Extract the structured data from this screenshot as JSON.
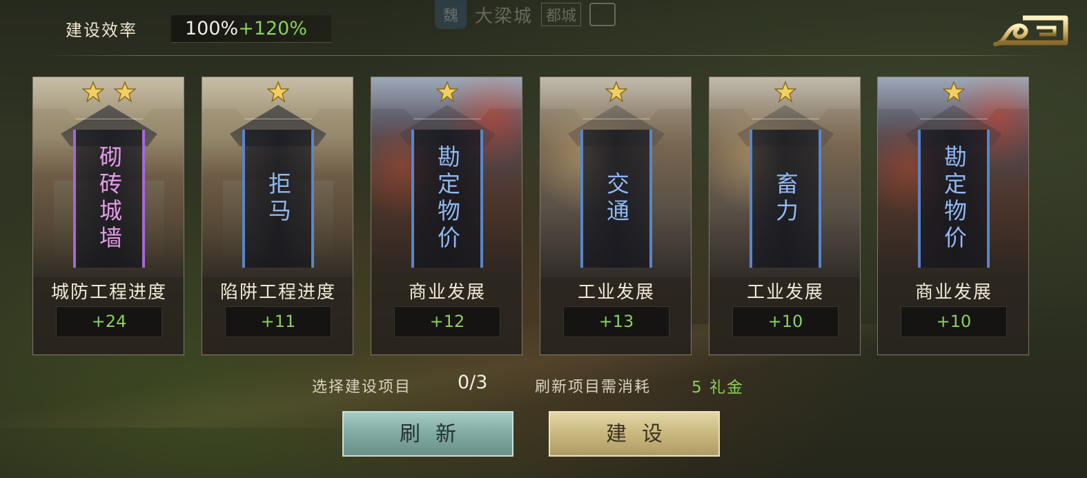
{
  "header": {
    "city_badge": "魏",
    "city_name": "大梁城",
    "city_tag": "都城"
  },
  "efficiency": {
    "label": "建设效率",
    "base": "100%",
    "bonus": "+120%"
  },
  "cards": [
    {
      "stars": 2,
      "title": "砌砖城墙",
      "banner_color": "purple",
      "category": "城防工程进度",
      "value": "+24",
      "art": "wall"
    },
    {
      "stars": 1,
      "title": "拒马",
      "banner_color": "blue",
      "category": "陷阱工程进度",
      "value": "+11",
      "art": "wall"
    },
    {
      "stars": 1,
      "title": "勘定物价",
      "banner_color": "blue",
      "category": "商业发展",
      "value": "+12",
      "art": "market"
    },
    {
      "stars": 1,
      "title": "交通",
      "banner_color": "blue",
      "category": "工业发展",
      "value": "+13",
      "art": "workshop"
    },
    {
      "stars": 1,
      "title": "畜力",
      "banner_color": "blue",
      "category": "工业发展",
      "value": "+10",
      "art": "workshop"
    },
    {
      "stars": 1,
      "title": "勘定物价",
      "banner_color": "blue",
      "category": "商业发展",
      "value": "+10",
      "art": "market"
    }
  ],
  "footer": {
    "select_label": "选择建设项目",
    "select_count": "0/3",
    "refresh_cost_label": "刷新项目需消耗",
    "refresh_cost_value": "5 礼金"
  },
  "buttons": {
    "refresh": "刷新",
    "build": "建设"
  },
  "colors": {
    "bonus_green": "#8bd15a",
    "banner_blue": "#5a86c8",
    "banner_purple": "#a36ad0",
    "refresh_button": "#7fa9a1",
    "build_button": "#c9b77e"
  },
  "icons": {
    "close": "close-swirl-icon",
    "share": "share-icon",
    "star": "star-icon"
  }
}
